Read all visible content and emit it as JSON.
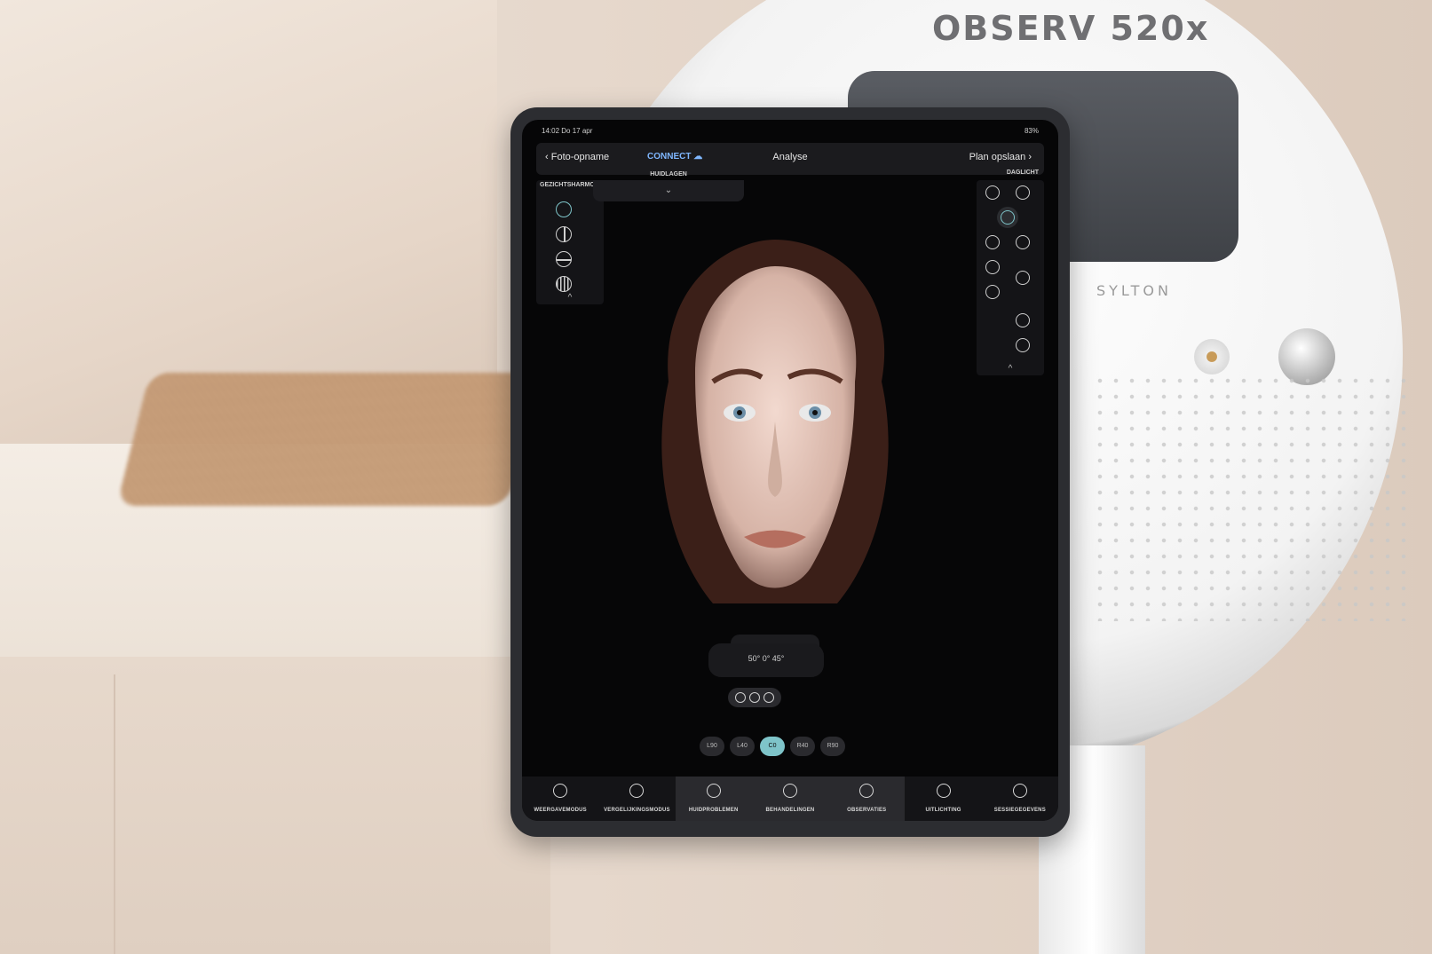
{
  "scene": {
    "device_brand": "OBSERV 520x",
    "device_sub_brand": "SYLTON"
  },
  "tablet": {
    "status": {
      "time": "14:02 Do 17 apr",
      "battery": "83%"
    },
    "topbar": {
      "back_label": "Foto-opname",
      "connect_label": "CONNECT",
      "title": "Analyse",
      "save_label": "Plan opslaan"
    },
    "left_panel": {
      "label": "GEZICHTSHARMONIE"
    },
    "center_panel": {
      "label": "HUIDLAGEN"
    },
    "right_panel": {
      "label": "DAGLICHT"
    },
    "angle_text": "50°  0°  45°",
    "positions": [
      "L90",
      "L40",
      "C0",
      "R40",
      "R90"
    ],
    "nav": [
      {
        "label": "WEERGAVEMODUS"
      },
      {
        "label": "VERGELIJKINGSMODUS"
      },
      {
        "label": "HUIDPROBLEMEN"
      },
      {
        "label": "BEHANDELINGEN"
      },
      {
        "label": "OBSERVATIES"
      },
      {
        "label": "UITLICHTING"
      },
      {
        "label": "SESSIEGEGEVENS"
      }
    ],
    "accent_color": "#7ec4c9"
  }
}
